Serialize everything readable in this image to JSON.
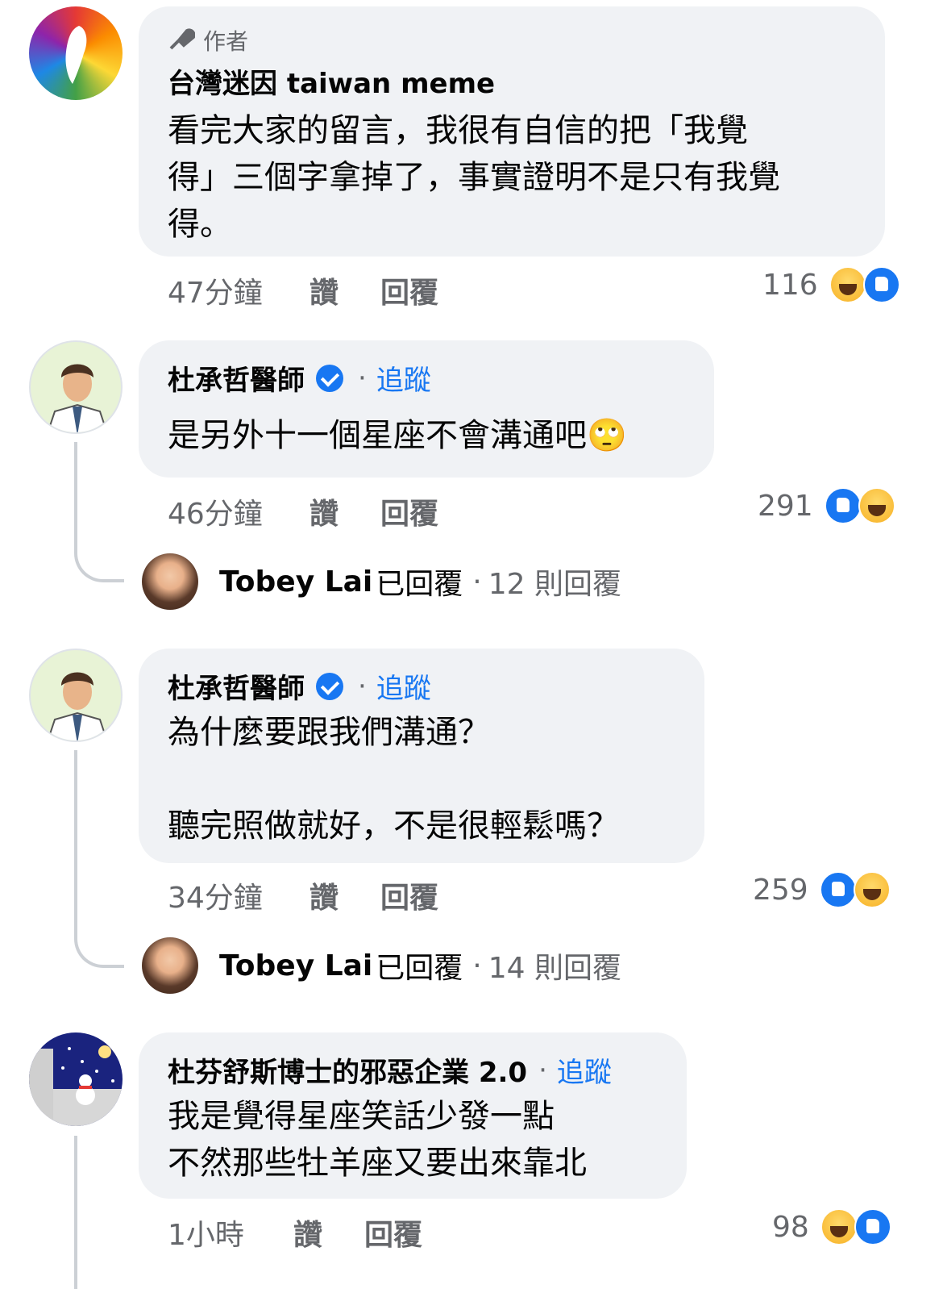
{
  "comments": [
    {
      "author_badge": "作者",
      "name": "台灣迷因 taiwan meme",
      "text_lines": [
        "看完大家的留言，我很有自信的把「我覺",
        "得」三個字拿掉了，事實證明不是只有我覺",
        "得。"
      ],
      "time": "47分鐘",
      "like_label": "讚",
      "reply_label": "回覆",
      "reaction_count": "116",
      "reactions": [
        "haha-icon",
        "like-icon"
      ]
    },
    {
      "name": "杜承哲醫師",
      "verified": true,
      "follow_label": "追蹤",
      "text_lines": [
        "是另外十一個星座不會溝通吧🙄"
      ],
      "time": "46分鐘",
      "like_label": "讚",
      "reply_label": "回覆",
      "reaction_count": "291",
      "reactions": [
        "like-icon",
        "haha-icon"
      ],
      "replies": {
        "name": "Tobey Lai",
        "suffix": "已回覆",
        "count": "12 則回覆"
      }
    },
    {
      "name": "杜承哲醫師",
      "verified": true,
      "follow_label": "追蹤",
      "text_lines": [
        "為什麼要跟我們溝通？",
        "",
        "聽完照做就好，不是很輕鬆嗎？"
      ],
      "time": "34分鐘",
      "like_label": "讚",
      "reply_label": "回覆",
      "reaction_count": "259",
      "reactions": [
        "like-icon",
        "haha-icon"
      ],
      "replies": {
        "name": "Tobey Lai",
        "suffix": "已回覆",
        "count": "14 則回覆"
      }
    },
    {
      "name": "杜芬舒斯博士的邪惡企業 2.0",
      "follow_label": "追蹤",
      "text_lines": [
        "我是覺得星座笑話少發一點",
        "不然那些牡羊座又要出來靠北"
      ],
      "time": "1小時",
      "like_label": "讚",
      "reply_label": "回覆",
      "reaction_count": "98",
      "reactions": [
        "haha-icon",
        "like-icon"
      ]
    }
  ],
  "colors": {
    "bubble": "#f0f2f5",
    "link": "#1877f2",
    "secondary": "#65676b"
  }
}
